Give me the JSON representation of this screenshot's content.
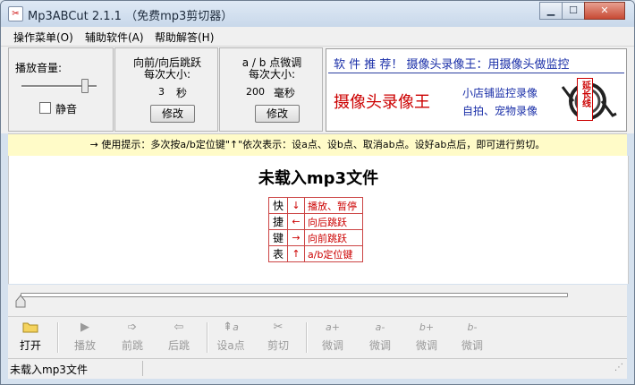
{
  "window": {
    "title": "Mp3ABCut 2.1.1 （免费mp3剪切器）",
    "icon": "scissors-app-icon",
    "controls": [
      "minimize",
      "maximize",
      "close"
    ]
  },
  "menu": [
    {
      "label": "操作菜单(O)"
    },
    {
      "label": "辅助软件(A)"
    },
    {
      "label": "帮助解答(H)"
    }
  ],
  "volume": {
    "label": "播放音量:",
    "level": 0.85,
    "mute_label": "静音",
    "muted": false
  },
  "jump": {
    "title": "向前/向后跳跃",
    "subtitle": "每次大小:",
    "value": "3",
    "unit": "秒",
    "edit_label": "修改"
  },
  "ab_adjust": {
    "title": "a / b 点微调",
    "subtitle": "每次大小:",
    "value": "200",
    "unit": "毫秒",
    "edit_label": "修改"
  },
  "ad": {
    "headline": "软 件 推 荐！ 摄像头录像王：用摄像头做监控",
    "big_text": "摄像头录像王",
    "line1": "小店铺监控录像",
    "line2": "自拍、宠物录像",
    "badge": "延长线"
  },
  "tip": "→ 使用提示：多次按a/b定位键\"↑\"依次表示：设a点、设b点、取消ab点。设好ab点后，即可进行剪切。",
  "status_heading": "未载入mp3文件",
  "shortcuts": {
    "labels": [
      "快",
      "捷",
      "键",
      "表"
    ],
    "rows": [
      {
        "arrow": "↓",
        "action": "播放、暂停"
      },
      {
        "arrow": "←",
        "action": "向后跳跃"
      },
      {
        "arrow": "→",
        "action": "向前跳跃"
      },
      {
        "arrow": "↑",
        "action": "a/b定位键"
      }
    ]
  },
  "seek": {
    "position": 0
  },
  "toolbar": [
    {
      "label": "打开",
      "icon": "folder-icon",
      "enabled": true
    },
    {
      "label": "播放",
      "icon": "play-icon",
      "enabled": false
    },
    {
      "label": "前跳",
      "icon": "forward-jump-icon",
      "enabled": false
    },
    {
      "label": "后跳",
      "icon": "backward-jump-icon",
      "enabled": false
    },
    {
      "label": "设a点",
      "icon": "set-a-point-icon",
      "enabled": false
    },
    {
      "label": "剪切",
      "icon": "scissors-icon",
      "enabled": false
    },
    {
      "label": "微调",
      "sign": "a+",
      "enabled": false
    },
    {
      "label": "微调",
      "sign": "a-",
      "enabled": false
    },
    {
      "label": "微调",
      "sign": "b+",
      "enabled": false
    },
    {
      "label": "微调",
      "sign": "b-",
      "enabled": false
    }
  ],
  "statusbar": "未载入mp3文件",
  "colors": {
    "tip_bg": "#fffbc8",
    "accent_red": "#cc0000",
    "ad_blue": "#1a2fa8"
  }
}
